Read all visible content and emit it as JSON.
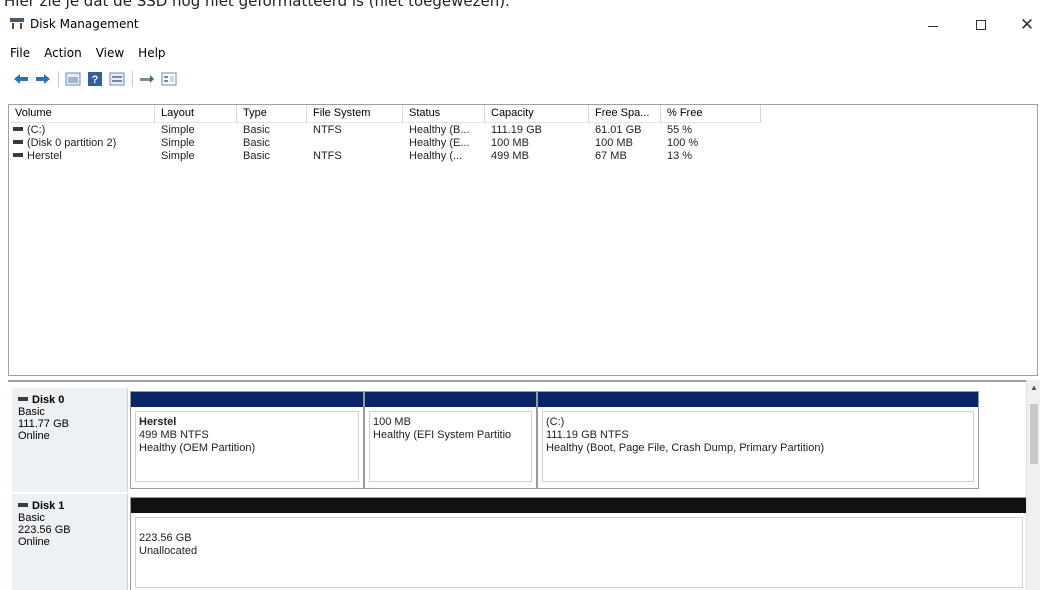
{
  "caption": "Hier zie je dat de SSD nog niet geformatteerd is (niet toegewezen).",
  "window": {
    "title": "Disk Management",
    "minimize_label": "—",
    "maximize_label": "☐",
    "close_label": "✕"
  },
  "menu": [
    {
      "label": "File"
    },
    {
      "label": "Action"
    },
    {
      "label": "View"
    },
    {
      "label": "Help"
    }
  ],
  "toolbar": {
    "buttons": [
      "back-icon",
      "forward-icon",
      "properties-icon",
      "help-icon",
      "disk-list-icon",
      "connect-icon",
      "console-icon"
    ]
  },
  "volume_list": {
    "columns": [
      "Volume",
      "Layout",
      "Type",
      "File System",
      "Status",
      "Capacity",
      "Free Spa...",
      "% Free"
    ],
    "rows": [
      {
        "volume": "(C:)",
        "layout": "Simple",
        "type": "Basic",
        "fs": "NTFS",
        "status": "Healthy (B...",
        "capacity": "111.19 GB",
        "free": "61.01 GB",
        "pct": "55 %"
      },
      {
        "volume": "(Disk 0 partition 2)",
        "layout": "Simple",
        "type": "Basic",
        "fs": "",
        "status": "Healthy (E...",
        "capacity": "100 MB",
        "free": "100 MB",
        "pct": "100 %"
      },
      {
        "volume": "Herstel",
        "layout": "Simple",
        "type": "Basic",
        "fs": "NTFS",
        "status": "Healthy (...",
        "capacity": "499 MB",
        "free": "67 MB",
        "pct": "13 %"
      }
    ]
  },
  "disks": [
    {
      "name": "Disk 0",
      "type": "Basic",
      "size": "111.77 GB",
      "state": "Online",
      "partitions": [
        {
          "title": "Herstel",
          "line1": "499 MB NTFS",
          "line2": "Healthy (OEM Partition)"
        },
        {
          "title": "",
          "line1": "100 MB",
          "line2": "Healthy (EFI System Partitio"
        },
        {
          "title": "(C:)",
          "line1": "111.19 GB NTFS",
          "line2": "Healthy (Boot, Page File, Crash Dump, Primary Partition)"
        }
      ]
    },
    {
      "name": "Disk 1",
      "type": "Basic",
      "size": "223.56 GB",
      "state": "Online",
      "partitions": [
        {
          "title": "",
          "line1": "223.56 GB",
          "line2": "Unallocated"
        }
      ]
    }
  ],
  "colors": {
    "primary_partition": "#0a246a",
    "unallocated": "#111111",
    "disk_label_bg": "#eef1f4"
  }
}
